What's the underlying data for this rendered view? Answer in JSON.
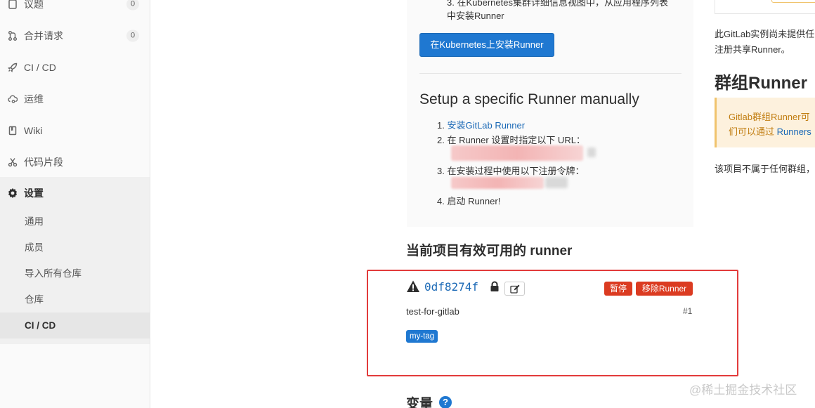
{
  "sidebar": {
    "items": [
      {
        "label": "议题",
        "count": "0",
        "icon": "issues-icon"
      },
      {
        "label": "合并请求",
        "count": "0",
        "icon": "merge-request-icon"
      },
      {
        "label": "CI / CD",
        "icon": "rocket-icon"
      },
      {
        "label": "运维",
        "icon": "cloud-gear-icon"
      },
      {
        "label": "Wiki",
        "icon": "book-icon"
      },
      {
        "label": "代码片段",
        "icon": "scissors-icon"
      }
    ],
    "settings": {
      "label": "设置",
      "icon": "gear-icon",
      "sub_items": [
        "通用",
        "成员",
        "导入所有仓库",
        "仓库",
        "CI / CD"
      ],
      "active_index": 4
    }
  },
  "k8s": {
    "step3_line1": "3. 在Kubernetes集群详细信息视图中，从应用程序列表",
    "step3_line2": "中安装Runner",
    "button_label": "在Kubernetes上安装Runner"
  },
  "manual": {
    "title": "Setup a specific Runner manually",
    "step1_prefix": "1. ",
    "step1_link": "安装GitLab Runner",
    "step2": "2. 在 Runner 设置时指定以下 URL：",
    "step3": "3. 在安装过程中使用以下注册令牌：",
    "step4": "4. 启动 Runner!"
  },
  "runners": {
    "title": "当前项目有效可用的 runner",
    "runner": {
      "id": "0df8274f",
      "pause_label": "暂停",
      "remove_label": "移除Runner",
      "description": "test-for-gitlab",
      "number": "#1",
      "tag": "my-tag"
    }
  },
  "variables": {
    "title": "变量",
    "help_glyph": "?"
  },
  "right": {
    "shared_line1": "此GitLab实例尚未提供任",
    "shared_line2": "注册共享Runner。",
    "group_title": "群组Runner",
    "warn_line1": "Gitlab群组Runner可",
    "warn_line2_prefix": "们可以通过 ",
    "warn_line2_link": "Runners",
    "no_group": "该项目不属于任何群组，"
  },
  "watermark": "@稀土掘金技术社区",
  "colors": {
    "primary": "#1f78d1",
    "danger": "#db3b21",
    "highlight": "#e23b3b",
    "warning_bg": "#fdf1dd"
  }
}
